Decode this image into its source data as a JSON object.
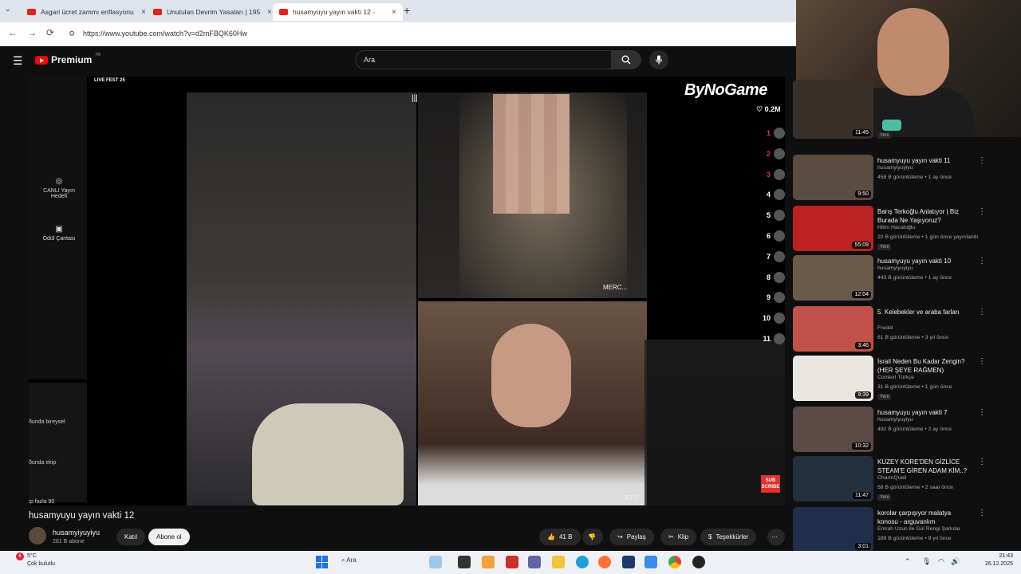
{
  "tabs": [
    {
      "title": "Asgari ücret zammı enflasyonu",
      "close": "×"
    },
    {
      "title": "Unutulan Devrim Yasaları | 195",
      "close": "×"
    },
    {
      "title": "husamyuyu yayın vakti 12 -",
      "close": "×"
    }
  ],
  "browser": {
    "url": "https://www.youtube.com/watch?v=d2mFBQK60Hw",
    "back_icon": "←",
    "forward_icon": "→",
    "reload_icon": "⟳",
    "new_tab_icon": "+",
    "tab_menu_icon": "⌄"
  },
  "youtube": {
    "logo_text": "Premium",
    "logo_region": "TR",
    "search_placeholder": "Ara"
  },
  "stream": {
    "live_fest": "LIVE FEST 25",
    "brand": "ByNoGame",
    "likes": "0.2M",
    "ranks": [
      "1",
      "2",
      "3",
      "4",
      "5",
      "6",
      "7",
      "8",
      "9",
      "10",
      "11"
    ],
    "left_panel": {
      "goal_label": "CANLI Yayın Hedefi",
      "bag_label": "Ödül Çantası",
      "low_items": [
        "ðunda bireysel",
        "ðunda ekip",
        "ıp fazla 90"
      ]
    },
    "cam_top_label": "MERC...",
    "cam_bottom_label": "BTC",
    "subscribe": "SUB SCRIBE"
  },
  "video": {
    "title": "husamyuyu yayın vakti 12",
    "channel": "husamyiyuyiyu",
    "subscribers": "281 B abone",
    "join": "Katıl",
    "subscribe": "Abone ol",
    "likes": "41 B",
    "share": "Paylaş",
    "clip": "Klip",
    "thanks": "Teşekkürler",
    "more": "···"
  },
  "recommendations": [
    {
      "title": "",
      "channel": "",
      "meta": "",
      "duration": "11:45",
      "badge": "Yeni"
    },
    {
      "title": "husamyuyu yayın vakti 11",
      "channel": "husamyiyuyiyu",
      "meta": "458 B görüntüleme • 1 ay önce",
      "duration": "9:50",
      "badge": ""
    },
    {
      "title": "Barış Terkoğlu Anlatıyor | Biz Burada Ne Yaşıyoruz?",
      "channel": "Hilmi Hacaloğlu",
      "meta": "20 B görüntüleme • 1 gün önce yayınlandı",
      "duration": "55:09",
      "badge": "Yeni"
    },
    {
      "title": "husamyuyu yayın vakti 10",
      "channel": "husamyiyuyiyu",
      "meta": "443 B görüntüleme • 1 ay önce",
      "duration": "12:04",
      "badge": ""
    },
    {
      "title": "5. Kelebekler ve araba farları",
      "channel": "Freddi",
      "meta": "61 B görüntüleme • 3 yıl önce",
      "duration": "3:46",
      "badge": ""
    },
    {
      "title": "İsrail Neden Bu Kadar Zengin? (HER ŞEYE RAĞMEN)",
      "channel": "Context Türkçe",
      "meta": "31 B görüntüleme • 1 gün önce",
      "duration": "9:39",
      "badge": "Yeni"
    },
    {
      "title": "husamyuyu yayın vakti 7",
      "channel": "husamyiyuyiyu",
      "meta": "492 B görüntüleme • 2 ay önce",
      "duration": "10:32",
      "badge": ""
    },
    {
      "title": "KUZEY KORE'DEN GİZLİCE STEAM'E GİREN ADAM KİM..?",
      "channel": "CharmQuell",
      "meta": "58 B görüntüleme • 2 saat önce",
      "duration": "11:47",
      "badge": "Yeni"
    },
    {
      "title": "korolar çarpışıyor malatya konosu - arguvanlım",
      "channel": "Emrah Uzun ile Gül Rengi Şarkılar",
      "meta": "189 B görüntüleme • 9 yıl önce",
      "duration": "3:01",
      "badge": ""
    }
  ],
  "taskbar": {
    "temp": "5°C",
    "weather": "Çok bulutlu",
    "notif": "6",
    "search": "Ara",
    "time": "21:43",
    "date": "26.12.2025"
  },
  "colors": {
    "accent_red": "#ff0000",
    "bg": "#0f0f0f",
    "pill": "#272727"
  }
}
